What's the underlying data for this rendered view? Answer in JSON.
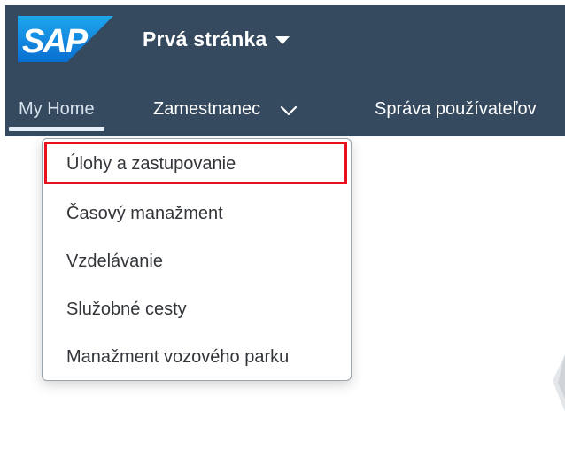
{
  "header": {
    "logo_text": "SAP",
    "page_title": "Prvá stránka",
    "caret_icon": "caret-down-icon"
  },
  "nav": {
    "tabs": [
      {
        "label": "My Home",
        "selected": true
      },
      {
        "label": "Zamestnanec",
        "icon": "chevron-down-icon"
      },
      {
        "label": "Správa používateľov"
      }
    ]
  },
  "menu": {
    "items": [
      {
        "label": "Úlohy a zastupovanie",
        "highlighted": true
      },
      {
        "label": "Časový manažment"
      },
      {
        "label": "Vzdelávanie"
      },
      {
        "label": "Služobné cesty"
      },
      {
        "label": "Manažment vozového parku"
      }
    ]
  },
  "colors": {
    "shell_bg": "#354a5f",
    "highlight_border": "#e8101c",
    "logo_blue": "#0a6ed1"
  }
}
